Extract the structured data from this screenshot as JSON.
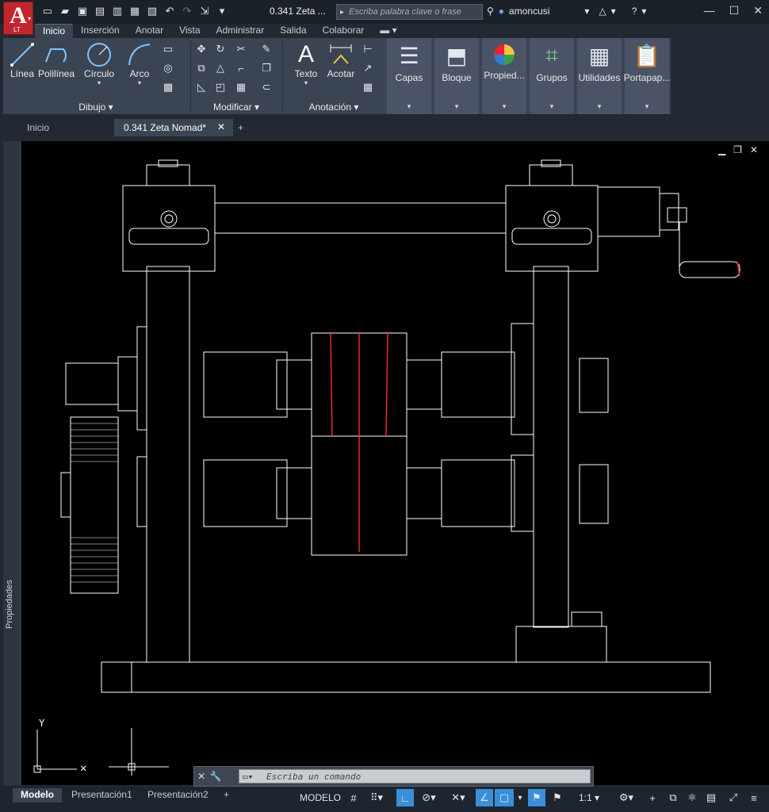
{
  "app": {
    "logo_letter": "A",
    "logo_sub": "LT",
    "doc_title": "0.341 Zeta ...",
    "search_placeholder": "Escriba palabra clave o frase",
    "user": "amoncusi"
  },
  "ribbon_tabs": [
    "Inicio",
    "Inserción",
    "Anotar",
    "Vista",
    "Administrar",
    "Salida",
    "Colaborar"
  ],
  "ribbon": {
    "draw": {
      "linea": "Línea",
      "polilinea": "Polilínea",
      "circulo": "Círculo",
      "arco": "Arco",
      "panel": "Dibujo"
    },
    "modify": {
      "panel": "Modificar"
    },
    "annotation": {
      "texto": "Texto",
      "acotar": "Acotar",
      "panel": "Anotación"
    },
    "big": [
      "Capas",
      "Bloque",
      "Propied...",
      "Grupos",
      "Utilidades",
      "Portapap..."
    ]
  },
  "file_tabs": {
    "start": "Inicio",
    "active": "0.341 Zeta Nomad*"
  },
  "side_panel": "Propiedades",
  "command": {
    "placeholder": "Escriba un comando"
  },
  "layout_tabs": [
    "Modelo",
    "Presentación1",
    "Presentación2"
  ],
  "status": {
    "modelo": "MODELO",
    "scale": "1:1"
  },
  "drawing_colors": {
    "line": "#ffffff",
    "accent": "#ff2a2a"
  }
}
